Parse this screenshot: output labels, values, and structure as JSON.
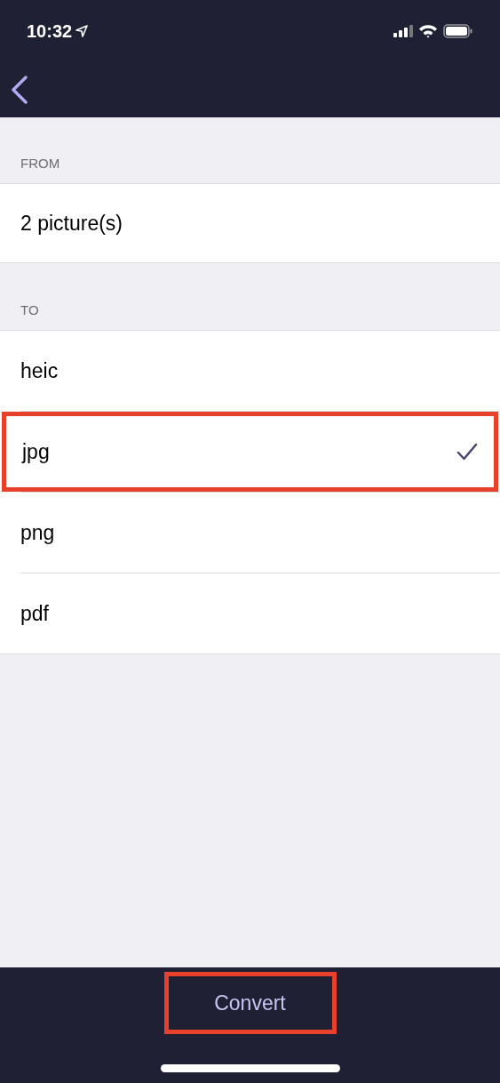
{
  "status_bar": {
    "time": "10:32"
  },
  "from": {
    "header": "FROM",
    "value": "2 picture(s)"
  },
  "to": {
    "header": "TO",
    "options": [
      {
        "label": "heic",
        "selected": false,
        "highlighted": false
      },
      {
        "label": "jpg",
        "selected": true,
        "highlighted": true
      },
      {
        "label": "png",
        "selected": false,
        "highlighted": false
      },
      {
        "label": "pdf",
        "selected": false,
        "highlighted": false
      }
    ]
  },
  "convert_button": {
    "label": "Convert",
    "highlighted": true
  }
}
